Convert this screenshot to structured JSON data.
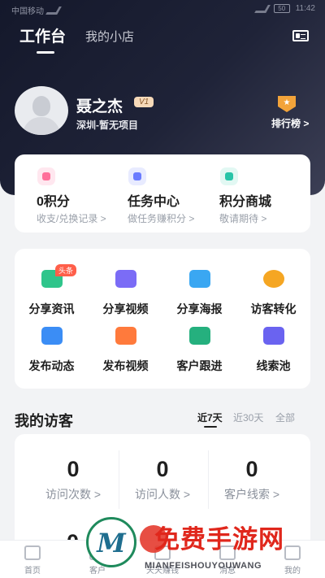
{
  "status": {
    "time": "11:42",
    "battery": "50",
    "left_text": "中国移动"
  },
  "header": {
    "tab_active": "工作台",
    "tab_other": "我的小店"
  },
  "profile": {
    "name": "聂之杰",
    "level": "V1",
    "location": "深圳-暂无项目",
    "rank_label": "排行榜 >"
  },
  "stats": [
    {
      "title": "0积分",
      "sub": "收支/兑换记录 >",
      "icon_color": "#ff6f9a"
    },
    {
      "title": "任务中心",
      "sub": "做任务赚积分 >",
      "icon_color": "#6b7cff"
    },
    {
      "title": "积分商城",
      "sub": "敬请期待 >",
      "icon_color": "#28c4a8"
    }
  ],
  "functions": [
    {
      "label": "分享资讯",
      "icon": "news-icon",
      "color": "#2fc58b",
      "tag": "头条"
    },
    {
      "label": "分享视频",
      "icon": "video-icon",
      "color": "#7b6cf6"
    },
    {
      "label": "分享海报",
      "icon": "poster-icon",
      "color": "#3aa7f2"
    },
    {
      "label": "访客转化",
      "icon": "visitor-convert-icon",
      "color": "#f5a623"
    },
    {
      "label": "发布动态",
      "icon": "publish-post-icon",
      "color": "#3b8df5"
    },
    {
      "label": "发布视频",
      "icon": "publish-video-icon",
      "color": "#ff7a3c"
    },
    {
      "label": "客户跟进",
      "icon": "customer-follow-icon",
      "color": "#25b07e"
    },
    {
      "label": "线索池",
      "icon": "lead-pool-icon",
      "color": "#6a63f0"
    }
  ],
  "visitors": {
    "title": "我的访客",
    "filters": [
      "近7天",
      "近30天",
      "全部"
    ],
    "stats": [
      {
        "num": "0",
        "label": "访问次数 >"
      },
      {
        "num": "0",
        "label": "访问人数 >"
      },
      {
        "num": "0",
        "label": "客户线索 >"
      }
    ],
    "row2_num": "0"
  },
  "bottom_nav": [
    {
      "label": "首页",
      "icon": "home-icon"
    },
    {
      "label": "客户",
      "icon": "customer-icon"
    },
    {
      "label": "天天赚钱",
      "icon": "earn-icon"
    },
    {
      "label": "消息",
      "icon": "message-icon"
    },
    {
      "label": "我的",
      "icon": "profile-icon"
    }
  ],
  "watermark": {
    "text": "免费手游网",
    "sub": "MIANFEISHOUYOUWANG",
    "logo": "M"
  }
}
